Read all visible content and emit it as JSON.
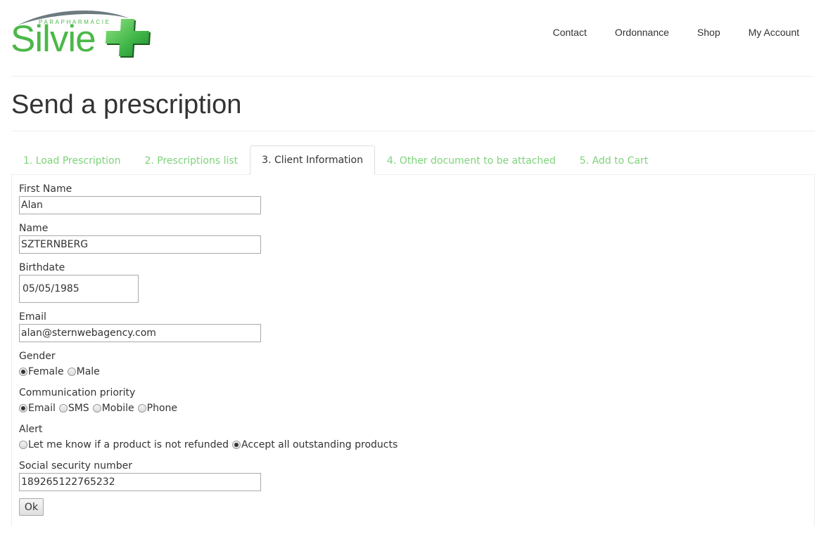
{
  "header": {
    "logo_text": "Silvie",
    "logo_subtext": "PARAPHARMACIE",
    "brand_color": "#4cb849",
    "nav": [
      "Contact",
      "Ordonnance",
      "Shop",
      "My Account"
    ]
  },
  "page_title": "Send a prescription",
  "tabs": [
    {
      "label": "1. Load Prescription",
      "active": false
    },
    {
      "label": "2. Prescriptions list",
      "active": false
    },
    {
      "label": "3. Client Information",
      "active": true
    },
    {
      "label": "4. Other document to be attached",
      "active": false
    },
    {
      "label": "5. Add to Cart",
      "active": false
    }
  ],
  "tab_color": "#7dd37a",
  "form": {
    "first_name": {
      "label": "First Name",
      "value": "Alan"
    },
    "name": {
      "label": "Name",
      "value": "SZTERNBERG"
    },
    "birthdate": {
      "label": "Birthdate",
      "value": "05/05/1985"
    },
    "email": {
      "label": "Email",
      "value": "alan@sternwebagency.com"
    },
    "gender": {
      "label": "Gender",
      "options": [
        "Female",
        "Male"
      ],
      "selected": "Female"
    },
    "communication": {
      "label": "Communication priority",
      "options": [
        "Email",
        "SMS",
        "Mobile",
        "Phone"
      ],
      "selected": "Email"
    },
    "alert": {
      "label": "Alert",
      "options": [
        "Let me know if a product is not refunded",
        "Accept all outstanding products"
      ],
      "selected": "Accept all outstanding products"
    },
    "ssn": {
      "label": "Social security number",
      "value": "189265122765232"
    },
    "submit_label": "Ok"
  }
}
